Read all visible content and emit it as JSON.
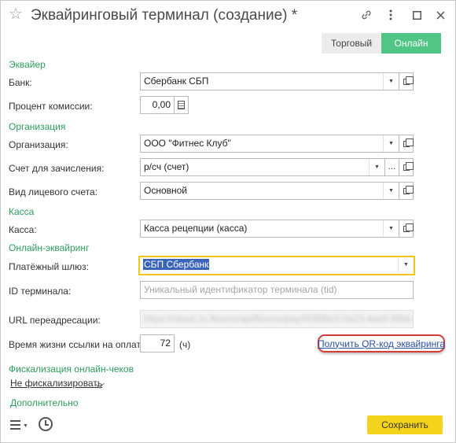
{
  "window": {
    "title": "Эквайринговый терминал (создание) *"
  },
  "tabs": {
    "trade": "Торговый",
    "online": "Онлайн"
  },
  "sections": {
    "acquirer": "Эквайер",
    "organization": "Организация",
    "cash": "Касса",
    "online_acquiring": "Онлайн-эквайринг",
    "fiscalization": "Фискализация онлайн-чеков"
  },
  "fields": {
    "bank": {
      "label": "Банк:",
      "value": "Сбербанк СБП"
    },
    "commission": {
      "label": "Процент комиссии:",
      "value": "0,00"
    },
    "organization": {
      "label": "Организация:",
      "value": "ООО \"Фитнес Клуб\""
    },
    "account": {
      "label": "Счет для зачисления:",
      "value": "р/сч (счет)"
    },
    "personal_account_type": {
      "label": "Вид лицевого счета:",
      "value": "Основной"
    },
    "cash_register": {
      "label": "Касса:",
      "value": "Касса рецепции (касса)"
    },
    "payment_gateway": {
      "label": "Платёжный шлюз:",
      "value": "СБП Сбербанк"
    },
    "terminal_id": {
      "label": "ID терминала:",
      "placeholder": "Уникальный идентификатор терминала (tid)"
    },
    "redirect_url": {
      "label": "URL переадресации:",
      "value": "https://cloud.1c.fitness/api/fitness/pay/f435f6e3-0a23-4ae5-8f8d-cea2f"
    },
    "link_lifetime": {
      "label": "Время жизни ссылки на оплату:",
      "value": "72",
      "unit": "(ч)"
    }
  },
  "actions": {
    "get_qr": "Получить QR-код эквайринга",
    "no_fiscalization": "Не фискализировать",
    "additional": "Дополнительно",
    "save": "Сохранить"
  },
  "icons": {
    "star": "star-icon",
    "link": "link-icon",
    "more": "more-vertical-icon",
    "maximize": "maximize-icon",
    "close": "close-icon",
    "menu": "menu-icon",
    "history": "history-icon"
  },
  "colors": {
    "accent_green": "#4fc685",
    "section_green": "#2d9d5b",
    "save_yellow": "#f4d31c",
    "highlight_border": "#f0c419",
    "qr_border": "#d43c3c"
  }
}
